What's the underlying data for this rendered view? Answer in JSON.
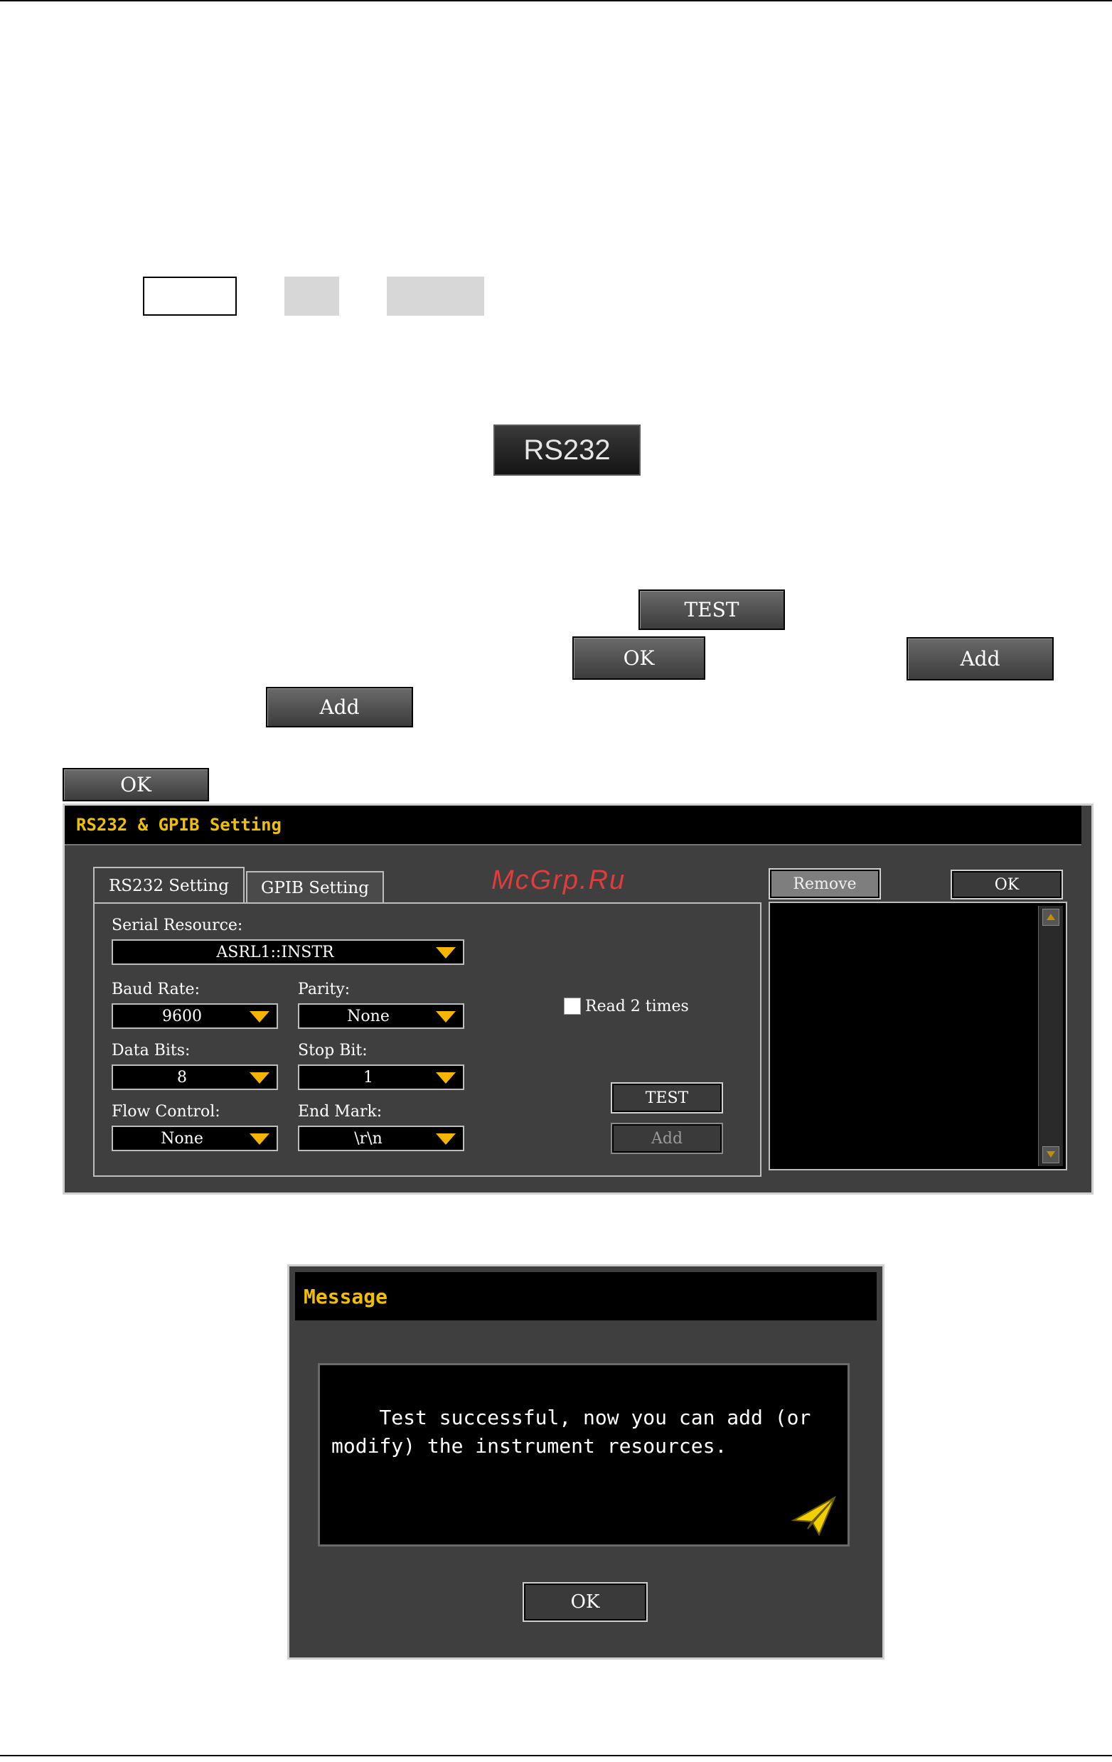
{
  "inline_buttons": {
    "rs232": "RS232",
    "test": "TEST",
    "ok_1": "OK",
    "add_1": "Add",
    "add_2": "Add",
    "ok_2": "OK"
  },
  "rs232_dialog": {
    "title": "RS232 & GPIB Setting",
    "tabs": [
      "RS232 Setting",
      "GPIB Setting"
    ],
    "watermark": "McGrp.Ru",
    "serial_resource": {
      "label": "Serial Resource:",
      "value": "ASRL1::INSTR"
    },
    "baud_rate": {
      "label": "Baud Rate:",
      "value": "9600"
    },
    "parity": {
      "label": "Parity:",
      "value": "None"
    },
    "data_bits": {
      "label": "Data Bits:",
      "value": "8"
    },
    "stop_bit": {
      "label": "Stop Bit:",
      "value": "1"
    },
    "flow_control": {
      "label": "Flow Control:",
      "value": "None"
    },
    "end_mark": {
      "label": "End Mark:",
      "value": "\\r\\n"
    },
    "read_twice": {
      "label": "Read 2 times",
      "checked": false
    },
    "test_button": "TEST",
    "add_button": "Add",
    "remove_button": "Remove",
    "ok_button": "OK"
  },
  "message_dialog": {
    "title": "Message",
    "text": "Test successful, now you can add (or\nmodify) the instrument resources.",
    "ok_button": "OK",
    "icon": "paper-plane-icon"
  },
  "colors": {
    "accent": "#f0c000",
    "dropdown_arrow": "#f4b400",
    "watermark": "#e03c3c"
  }
}
